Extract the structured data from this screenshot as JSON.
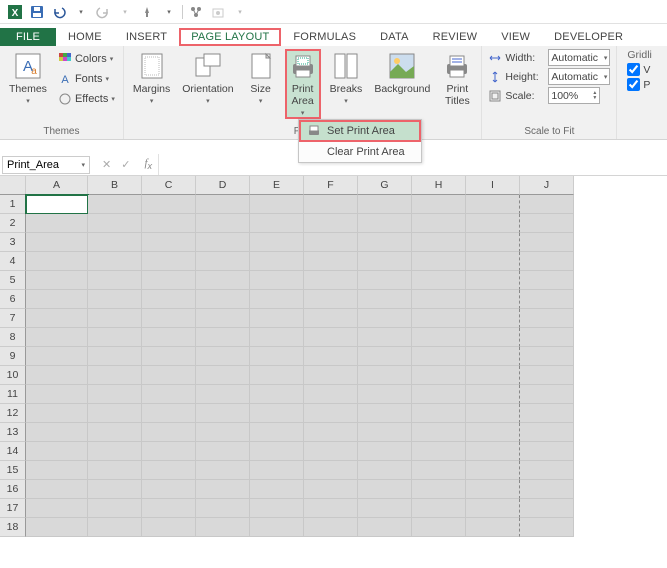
{
  "qat": {
    "excel": "X▦"
  },
  "tabs": {
    "file": "FILE",
    "home": "HOME",
    "insert": "INSERT",
    "page_layout": "PAGE LAYOUT",
    "formulas": "FORMULAS",
    "data": "DATA",
    "review": "REVIEW",
    "view": "VIEW",
    "developer": "DEVELOPER"
  },
  "ribbon": {
    "themes": {
      "label": "Themes",
      "themes_btn": "Themes",
      "colors": "Colors",
      "fonts": "Fonts",
      "effects": "Effects"
    },
    "page_setup": {
      "label": "Pag",
      "margins": "Margins",
      "orientation": "Orientation",
      "size": "Size",
      "print_area": "Print\nArea",
      "breaks": "Breaks",
      "background": "Background",
      "print_titles": "Print\nTitles"
    },
    "scale": {
      "label": "Scale to Fit",
      "width": "Width:",
      "height": "Height:",
      "scale": "Scale:",
      "auto": "Automatic",
      "pct": "100%"
    },
    "sheet": {
      "gridlines": "Gridli",
      "view": "V",
      "print": "P"
    }
  },
  "dropdown": {
    "set": "Set Print Area",
    "clear": "Clear Print Area"
  },
  "namebox": "Print_Area",
  "columns": [
    "A",
    "B",
    "C",
    "D",
    "E",
    "F",
    "G",
    "H",
    "I",
    "J"
  ],
  "rows": [
    1,
    2,
    3,
    4,
    5,
    6,
    7,
    8,
    9,
    10,
    11,
    12,
    13,
    14,
    15,
    16,
    17,
    18
  ]
}
